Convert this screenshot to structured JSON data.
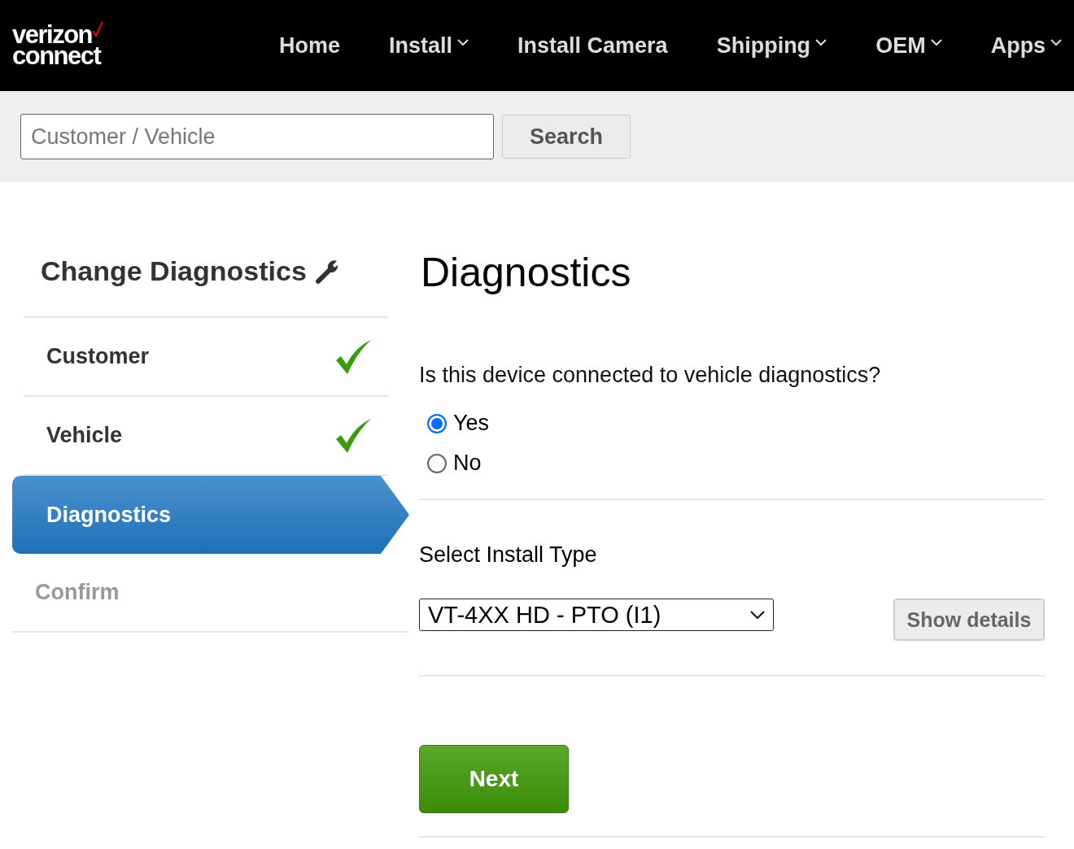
{
  "header": {
    "logo": {
      "line_1": "verizon",
      "line_2": "connect"
    },
    "nav": [
      {
        "label": "Home",
        "dropdown": false
      },
      {
        "label": "Install",
        "dropdown": true
      },
      {
        "label": "Install Camera",
        "dropdown": false
      },
      {
        "label": "Shipping",
        "dropdown": true
      },
      {
        "label": "OEM",
        "dropdown": true
      },
      {
        "label": "Apps",
        "dropdown": true
      }
    ]
  },
  "search": {
    "placeholder": "Customer / Vehicle",
    "button": "Search"
  },
  "sidebar": {
    "title": "Change Diagnostics",
    "steps": [
      {
        "label": "Customer",
        "done": true,
        "selected": false,
        "disabled": false
      },
      {
        "label": "Vehicle",
        "done": true,
        "selected": false,
        "disabled": false
      },
      {
        "label": "Diagnostics",
        "done": false,
        "selected": true,
        "disabled": false
      },
      {
        "label": "Confirm",
        "done": false,
        "selected": false,
        "disabled": true
      }
    ]
  },
  "main": {
    "title": "Diagnostics",
    "question": "Is this device connected to vehicle diagnostics?",
    "options": [
      {
        "label": "Yes",
        "selected": true
      },
      {
        "label": "No",
        "selected": false
      }
    ],
    "install_type_label": "Select Install Type",
    "install_type_value": "VT-4XX HD - PTO (I1)",
    "details_button": "Show details",
    "next_button": "Next"
  }
}
